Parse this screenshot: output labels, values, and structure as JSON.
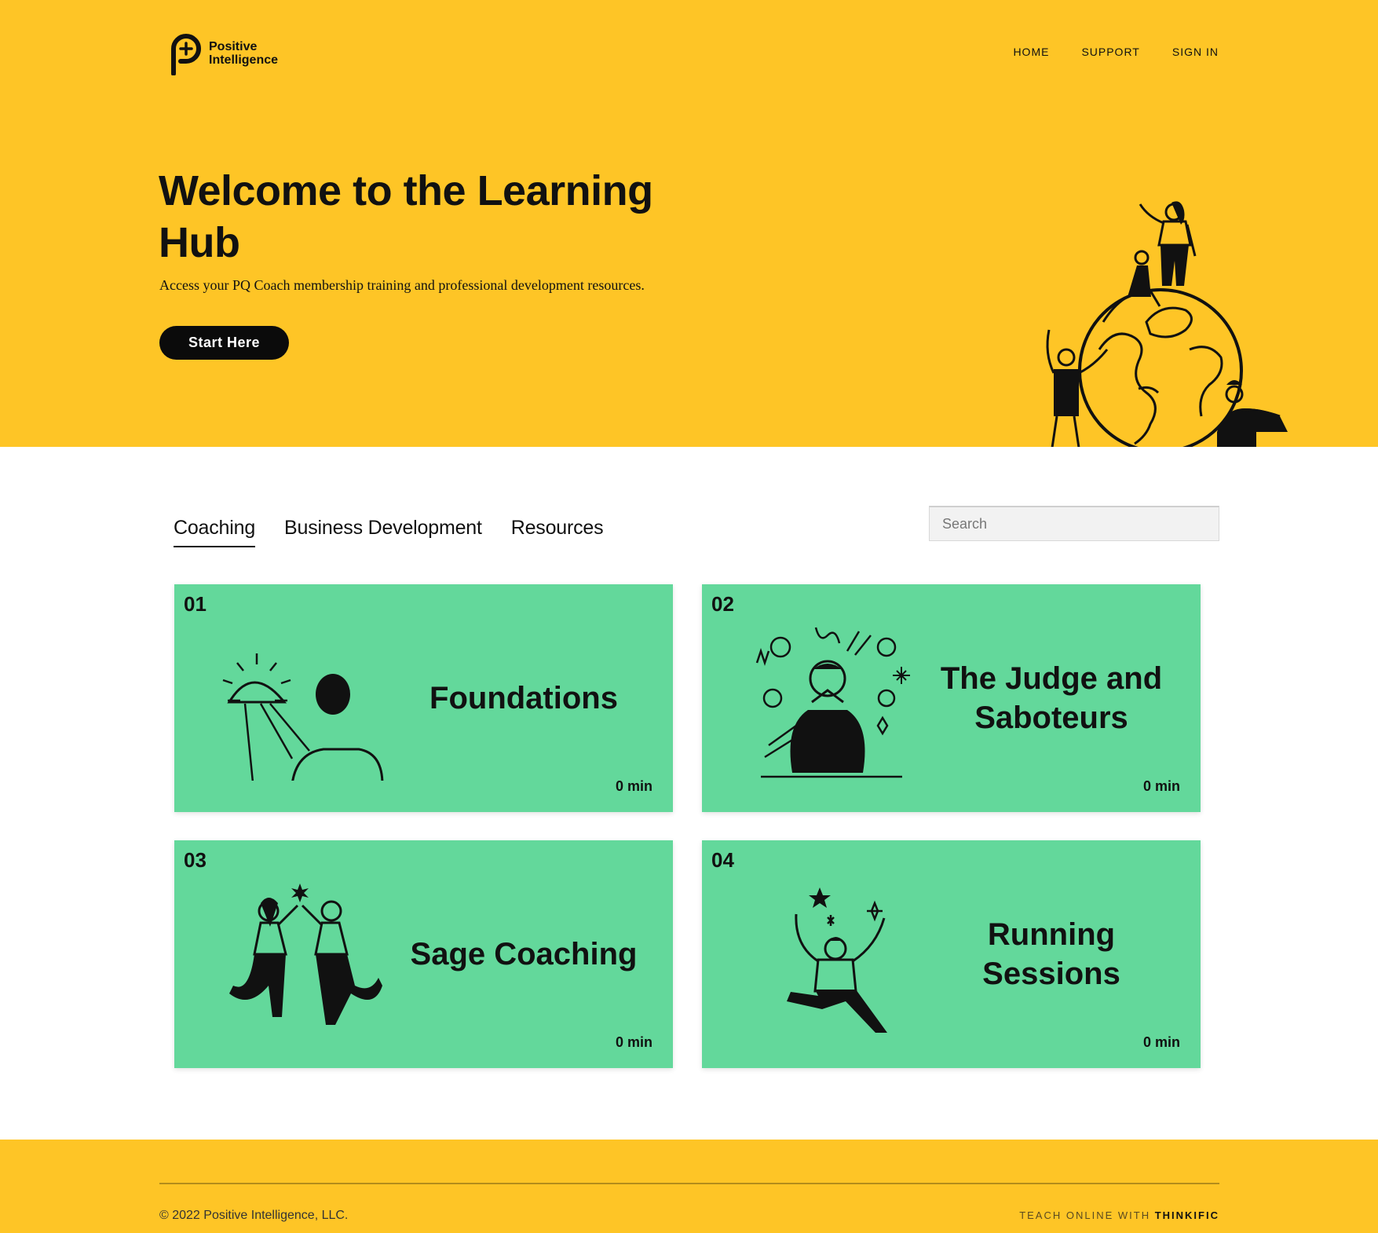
{
  "brand": {
    "name_line1": "Positive",
    "name_line2": "Intelligence",
    "logo_icon": "p-plus-logo-icon",
    "color_primary": "#FEC526",
    "color_card": "#63D89B"
  },
  "nav": {
    "items": [
      {
        "label": "HOME"
      },
      {
        "label": "SUPPORT"
      },
      {
        "label": "SIGN IN"
      }
    ]
  },
  "hero": {
    "title": "Welcome to the Learning Hub",
    "subtitle": "Access your PQ Coach membership training and professional development resources.",
    "cta_label": "Start Here"
  },
  "tabs": [
    {
      "label": "Coaching",
      "active": true
    },
    {
      "label": "Business Development",
      "active": false
    },
    {
      "label": "Resources",
      "active": false
    }
  ],
  "search": {
    "placeholder": "Search",
    "value": ""
  },
  "cards": [
    {
      "number": "01",
      "title": "Foundations",
      "duration": "0 min",
      "icon": "sunrise-person-icon"
    },
    {
      "number": "02",
      "title": "The Judge and Saboteurs",
      "duration": "0 min",
      "icon": "judge-saboteurs-icon"
    },
    {
      "number": "03",
      "title": "Sage Coaching",
      "duration": "0 min",
      "icon": "high-five-icon"
    },
    {
      "number": "04",
      "title": "Running Sessions",
      "duration": "0 min",
      "icon": "jumping-person-icon"
    }
  ],
  "footer": {
    "copyright": "© 2022 Positive Intelligence, LLC.",
    "powered_prefix": "TEACH ONLINE WITH",
    "powered_brand": "THINKIFIC"
  }
}
